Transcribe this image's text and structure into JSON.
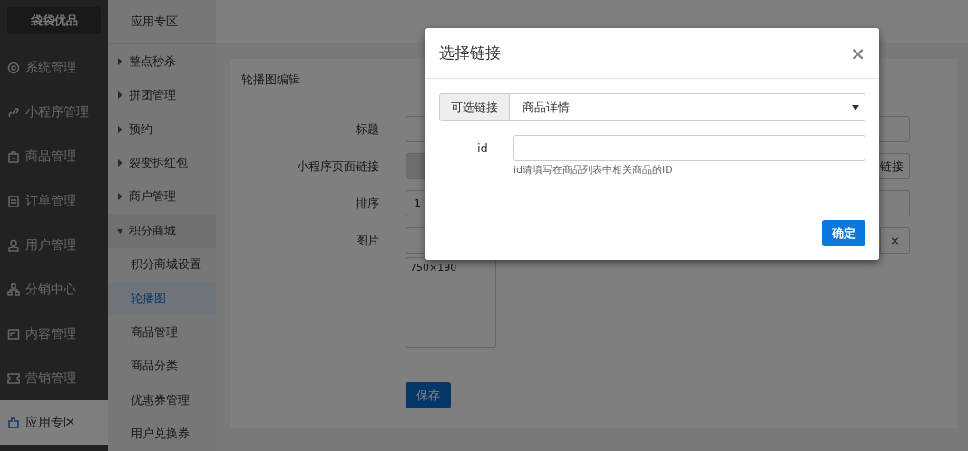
{
  "brand": "袋袋优品",
  "sidebar": {
    "items": [
      {
        "label": "系统管理",
        "selected": false
      },
      {
        "label": "小程序管理",
        "selected": false
      },
      {
        "label": "商品管理",
        "selected": false
      },
      {
        "label": "订单管理",
        "selected": false
      },
      {
        "label": "用户管理",
        "selected": false
      },
      {
        "label": "分销中心",
        "selected": false
      },
      {
        "label": "内容管理",
        "selected": false
      },
      {
        "label": "营销管理",
        "selected": false
      },
      {
        "label": "应用专区",
        "selected": true
      }
    ]
  },
  "submenu": {
    "title": "应用专区",
    "items": [
      {
        "label": "整点秒杀",
        "kind": "group",
        "expanded": false,
        "selected": false
      },
      {
        "label": "拼团管理",
        "kind": "group",
        "expanded": false,
        "selected": false
      },
      {
        "label": "预约",
        "kind": "group",
        "expanded": false,
        "selected": false
      },
      {
        "label": "裂变拆红包",
        "kind": "group",
        "expanded": false,
        "selected": false
      },
      {
        "label": "商户管理",
        "kind": "group",
        "expanded": false,
        "selected": false
      },
      {
        "label": "积分商城",
        "kind": "group",
        "expanded": true,
        "selected": false
      },
      {
        "label": "积分商城设置",
        "kind": "link",
        "selected": false
      },
      {
        "label": "轮播图",
        "kind": "link",
        "selected": true
      },
      {
        "label": "商品管理",
        "kind": "link",
        "selected": false
      },
      {
        "label": "商品分类",
        "kind": "link",
        "selected": false
      },
      {
        "label": "优惠券管理",
        "kind": "link",
        "selected": false
      },
      {
        "label": "用户兑换券",
        "kind": "link",
        "selected": false
      }
    ]
  },
  "form": {
    "title": "轮播图编辑",
    "rows": [
      {
        "label": "标题",
        "kind": "text"
      },
      {
        "label": "小程序页面链接",
        "kind": "link",
        "disabled": true,
        "button": "链接"
      },
      {
        "label": "排序",
        "kind": "text",
        "value": "1"
      },
      {
        "label": "图片",
        "kind": "image",
        "clear": "×",
        "preview": "750×190"
      }
    ],
    "save": "保存"
  },
  "dialog": {
    "title": "选择链接",
    "close": "×",
    "addon": "可选链接",
    "select": "商品详情",
    "id_label": "id",
    "id_help": "id请填写在商品列表中相关商品的ID",
    "confirm": "确定"
  }
}
